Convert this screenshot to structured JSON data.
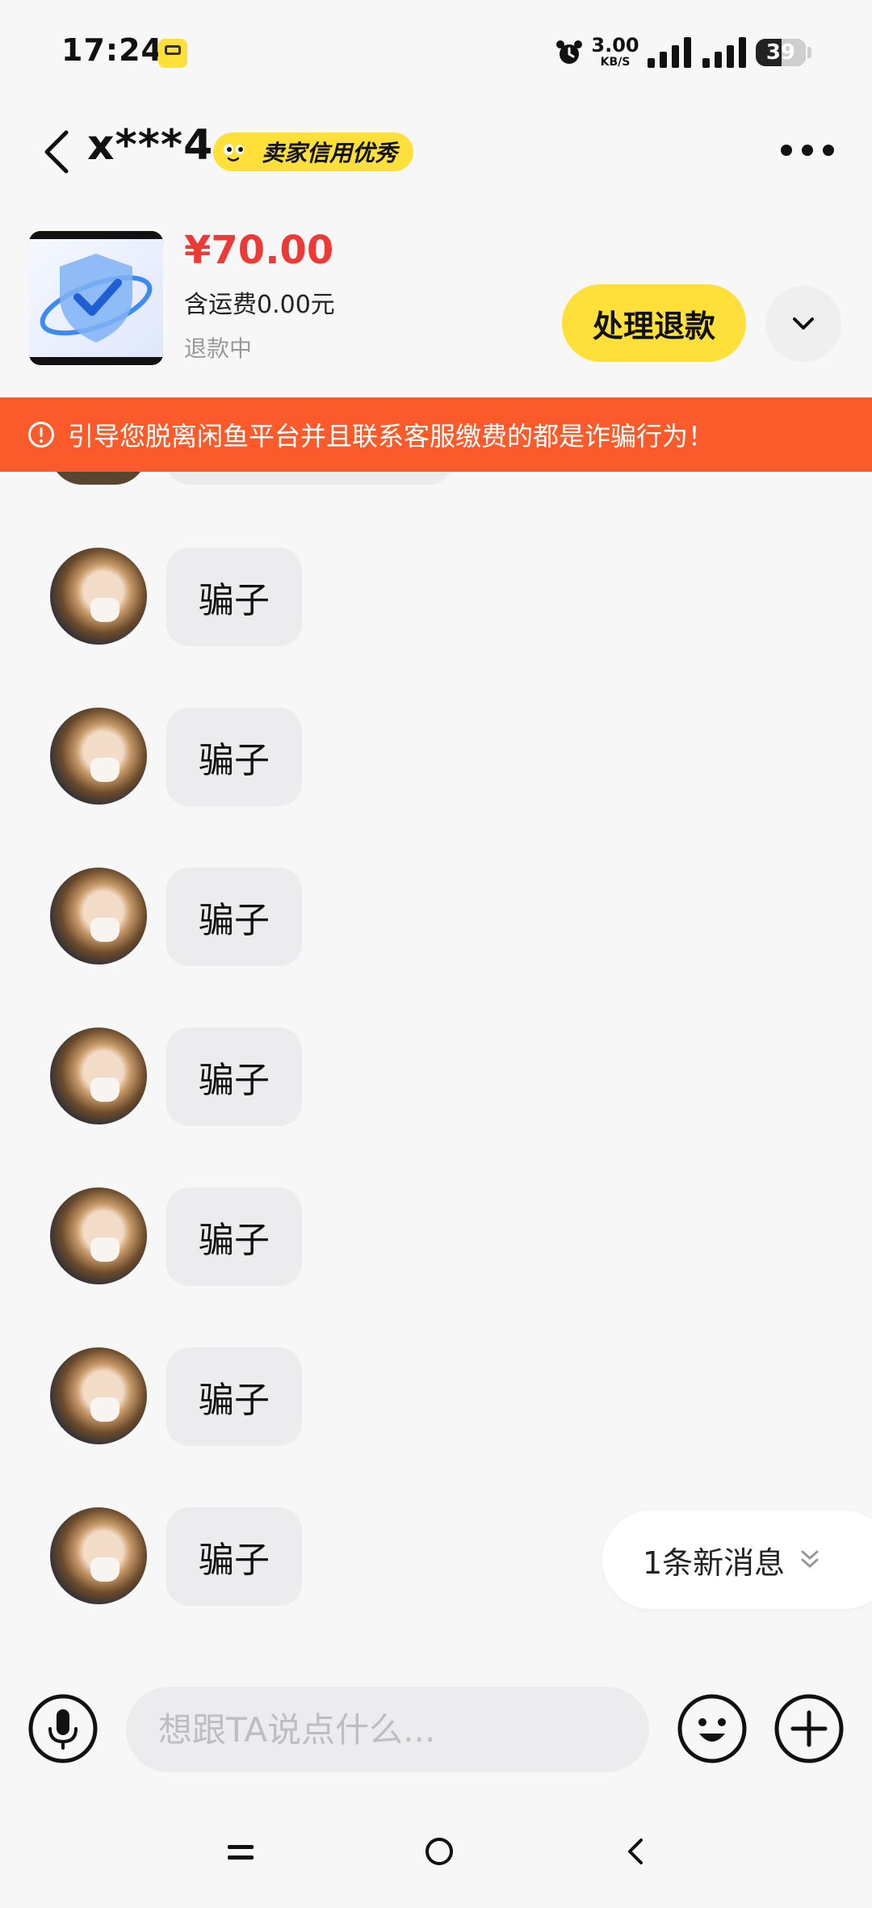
{
  "status_bar": {
    "time": "17:24",
    "net_speed_value": "3.00",
    "net_speed_unit": "KB/S",
    "battery": "39"
  },
  "header": {
    "contact_name": "x***4",
    "credit_badge": "卖家信用优秀"
  },
  "order": {
    "price": "¥70.00",
    "shipping": "含运费0.00元",
    "status": "退款中",
    "refund_button": "处理退款"
  },
  "warning": {
    "text": "引导您脱离闲鱼平台并且联系客服缴费的都是诈骗行为！"
  },
  "messages": [
    {
      "text": "骗子"
    },
    {
      "text": "骗子"
    },
    {
      "text": "骗子"
    },
    {
      "text": "骗子"
    },
    {
      "text": "骗子"
    },
    {
      "text": "骗子"
    },
    {
      "text": "骗子"
    }
  ],
  "new_message_pill": "1条新消息",
  "input": {
    "placeholder": "想跟TA说点什么..."
  },
  "colors": {
    "accent_yellow": "#ffe03a",
    "warning_orange": "#fb5a2a",
    "price_red": "#ec3b37"
  }
}
